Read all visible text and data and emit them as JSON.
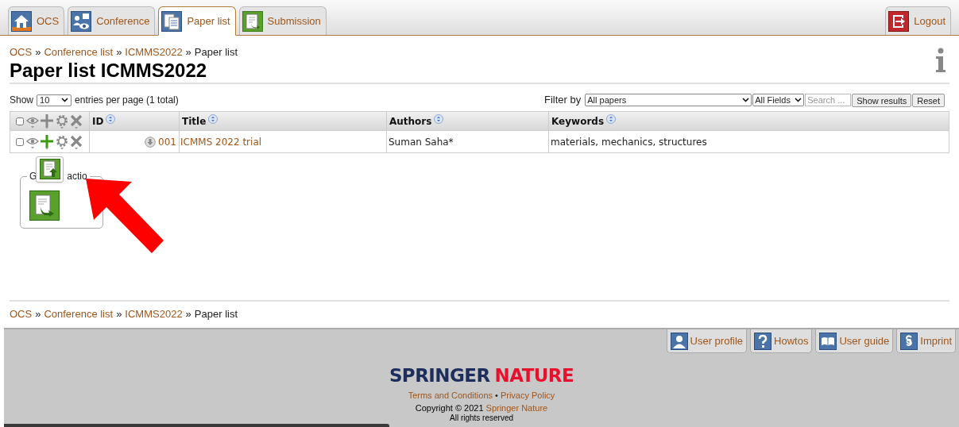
{
  "tabs": [
    {
      "label": "OCS",
      "selected": false
    },
    {
      "label": "Conference",
      "selected": false
    },
    {
      "label": "Paper list",
      "selected": true
    },
    {
      "label": "Submission",
      "selected": false
    }
  ],
  "logout": {
    "label": "Logout"
  },
  "breadcrumb_separator": "»",
  "breadcrumb": [
    {
      "label": "OCS",
      "link": true
    },
    {
      "label": "Conference list",
      "link": true
    },
    {
      "label": "ICMMS2022",
      "link": true
    },
    {
      "label": "Paper list",
      "link": false
    }
  ],
  "heading": "Paper list ICMMS2022",
  "paging": {
    "before": "Show",
    "page_size": "10",
    "after": "entries per page (1 total)"
  },
  "filter": {
    "label": "Filter by",
    "paper_select": "All papers",
    "field_select": "All Fields",
    "search_placeholder": "Search ...",
    "buttons": [
      "Show results",
      "Reset"
    ]
  },
  "table": {
    "header_checked": false,
    "columns": [
      {
        "label": "ID"
      },
      {
        "label": "Title"
      },
      {
        "label": "Authors"
      },
      {
        "label": "Keywords"
      }
    ],
    "rows": [
      {
        "checked": false,
        "id": "001",
        "title": "ICMMS 2022 trial",
        "authors": "Suman Saha*",
        "keywords": "materials, mechanics, structures"
      }
    ]
  },
  "group_actions": {
    "legend_parts": [
      "G",
      "actio"
    ]
  },
  "footer_breadcrumb": [
    {
      "label": "OCS",
      "link": true
    },
    {
      "label": "Conference list",
      "link": true
    },
    {
      "label": "ICMMS2022",
      "link": true
    },
    {
      "label": "Paper list",
      "link": false
    }
  ],
  "footer_breadcrumb_separator": "»",
  "footer_tabs": [
    {
      "label": "User profile"
    },
    {
      "label": "Howtos"
    },
    {
      "label": "User guide"
    },
    {
      "label": "Imprint"
    }
  ],
  "brand": [
    "SPRINGER",
    "NATURE"
  ],
  "legal_links": [
    "Terms and Conditions",
    "Privacy Policy"
  ],
  "legal_separator": "•",
  "copyright": {
    "text": "Copyright © 2021",
    "link": "Springer Nature"
  },
  "rights": "All rights reserved"
}
